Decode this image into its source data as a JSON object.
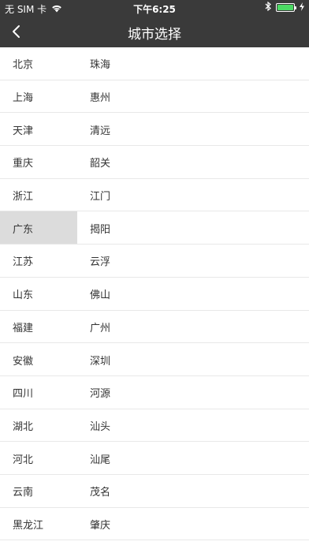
{
  "status_bar": {
    "carrier": "无 SIM 卡",
    "time": "下午6:25",
    "icons": [
      "wifi-icon",
      "bluetooth-icon",
      "battery-icon",
      "charging-icon"
    ],
    "battery_color": "#4cd964"
  },
  "nav": {
    "title": "城市选择",
    "back_icon": "chevron-left-icon",
    "bg_color": "#3a3a3a"
  },
  "provinces": [
    {
      "label": "北京"
    },
    {
      "label": "上海"
    },
    {
      "label": "天津"
    },
    {
      "label": "重庆"
    },
    {
      "label": "浙江"
    },
    {
      "label": "广东",
      "selected": true
    },
    {
      "label": "江苏"
    },
    {
      "label": "山东"
    },
    {
      "label": "福建"
    },
    {
      "label": "安徽"
    },
    {
      "label": "四川"
    },
    {
      "label": "湖北"
    },
    {
      "label": "河北"
    },
    {
      "label": "云南"
    },
    {
      "label": "黑龙江"
    }
  ],
  "cities": [
    {
      "label": "珠海"
    },
    {
      "label": "惠州"
    },
    {
      "label": "清远"
    },
    {
      "label": "韶关"
    },
    {
      "label": "江门"
    },
    {
      "label": "揭阳"
    },
    {
      "label": "云浮"
    },
    {
      "label": "佛山"
    },
    {
      "label": "广州"
    },
    {
      "label": "深圳"
    },
    {
      "label": "河源"
    },
    {
      "label": "汕头"
    },
    {
      "label": "汕尾"
    },
    {
      "label": "茂名"
    },
    {
      "label": "肇庆"
    }
  ],
  "colors": {
    "selected_bg": "#dcdcdc",
    "separator": "#e8e8e8"
  }
}
